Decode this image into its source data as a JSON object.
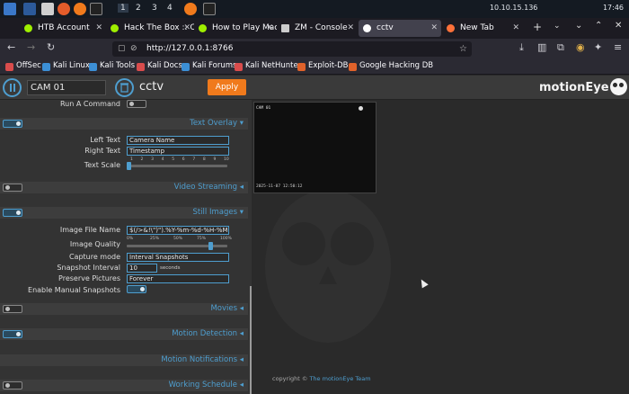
{
  "taskbar": {
    "workspaces": [
      "1",
      "2",
      "3",
      "4"
    ],
    "ip": "10.10.15.136",
    "clock": "17:46"
  },
  "browser": {
    "tabs": [
      {
        "label": "HTB Account",
        "color": "#9fef00"
      },
      {
        "label": "Hack The Box :: C",
        "color": "#9fef00"
      },
      {
        "label": "How to Play Mach",
        "color": "#9fef00"
      },
      {
        "label": "ZM - Console",
        "color": "#cccccc"
      },
      {
        "label": "cctv",
        "color": "#ffffff"
      },
      {
        "label": "New Tab",
        "color": "#ff7139"
      }
    ],
    "url": "http://127.0.0.1:8766",
    "bookmarks": [
      {
        "label": "OffSec",
        "color": "#d94c4c"
      },
      {
        "label": "Kali Linux",
        "color": "#3c8fd6"
      },
      {
        "label": "Kali Tools",
        "color": "#3c8fd6"
      },
      {
        "label": "Kali Docs",
        "color": "#d94c4c"
      },
      {
        "label": "Kali Forums",
        "color": "#3c8fd6"
      },
      {
        "label": "Kali NetHunter",
        "color": "#d94c4c"
      },
      {
        "label": "Exploit-DB",
        "color": "#e0622a"
      },
      {
        "label": "Google Hacking DB",
        "color": "#e0622a"
      }
    ]
  },
  "header": {
    "camera": "CAM 01",
    "title": "cctv",
    "apply_label": "Apply",
    "brand": "motionEye"
  },
  "settings": {
    "run_a_command": "Run A Command",
    "text_overlay": {
      "title": "Text Overlay",
      "left_text_label": "Left Text",
      "left_text_value": "Camera Name",
      "right_text_label": "Right Text",
      "right_text_value": "Timestamp",
      "text_scale_label": "Text Scale",
      "scale_ticks": [
        "1",
        "2",
        "3",
        "4",
        "5",
        "6",
        "7",
        "8",
        "9",
        "10"
      ],
      "text_scale_value": 1
    },
    "video_streaming": {
      "title": "Video Streaming"
    },
    "still_images": {
      "title": "Still Images",
      "file_name_label": "Image File Name",
      "file_name_value": "$(/>&!\\\")\").%Y-%m-%d-%H-%M-%S",
      "quality_label": "Image Quality",
      "quality_ticks": [
        "0%",
        "25%",
        "50%",
        "75%",
        "100%"
      ],
      "quality_value": 85,
      "capture_mode_label": "Capture mode",
      "capture_mode_value": "Interval Snapshots",
      "snapshot_interval_label": "Snapshot Interval",
      "snapshot_interval_value": "10",
      "snapshot_interval_unit": "seconds",
      "preserve_label": "Preserve Pictures",
      "preserve_value": "Forever",
      "manual_label": "Enable Manual Snapshots"
    },
    "movies": {
      "title": "Movies"
    },
    "motion_detection": {
      "title": "Motion Detection"
    },
    "motion_notifications": {
      "title": "Motion Notifications"
    },
    "working_schedule": {
      "title": "Working Schedule"
    }
  },
  "preview": {
    "overlay_name": "CAM 01",
    "overlay_timestamp": "2025-11-07 12:50:12"
  },
  "footer": {
    "text": "copyright ©",
    "link": "The motionEye Team"
  }
}
